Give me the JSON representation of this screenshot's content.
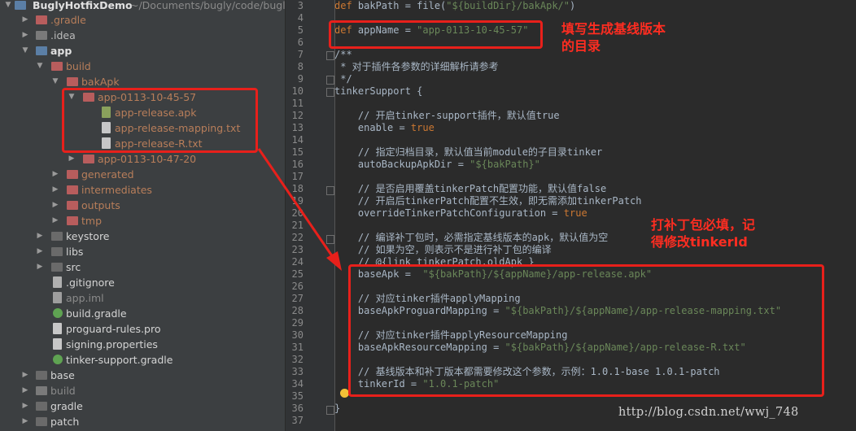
{
  "tree": {
    "root": {
      "label": "BuglyHotfixDemo",
      "path": "~/Documents/bugly/code/bugly-"
    },
    "items": [
      {
        "label": ".gradle"
      },
      {
        "label": ".idea"
      },
      {
        "label": "app"
      },
      {
        "label": "build"
      },
      {
        "label": "bakApk"
      },
      {
        "label": "app-0113-10-45-57"
      },
      {
        "label": "app-release.apk"
      },
      {
        "label": "app-release-mapping.txt"
      },
      {
        "label": "app-release-R.txt"
      },
      {
        "label": "app-0113-10-47-20"
      },
      {
        "label": "generated"
      },
      {
        "label": "intermediates"
      },
      {
        "label": "outputs"
      },
      {
        "label": "tmp"
      },
      {
        "label": "keystore"
      },
      {
        "label": "libs"
      },
      {
        "label": "src"
      },
      {
        "label": ".gitignore"
      },
      {
        "label": "app.iml"
      },
      {
        "label": "build.gradle"
      },
      {
        "label": "proguard-rules.pro"
      },
      {
        "label": "signing.properties"
      },
      {
        "label": "tinker-support.gradle"
      },
      {
        "label": "base"
      },
      {
        "label": "build"
      },
      {
        "label": "gradle"
      },
      {
        "label": "patch"
      }
    ]
  },
  "gutter": {
    "line_numbers": [
      "3",
      "4",
      "5",
      "6",
      "7",
      "8",
      "9",
      "10",
      "11",
      "12",
      "13",
      "14",
      "15",
      "16",
      "17",
      "18",
      "19",
      "20",
      "21",
      "22",
      "23",
      "24",
      "25",
      "26",
      "27",
      "28",
      "29",
      "30",
      "31",
      "32",
      "33",
      "34",
      "35",
      "36",
      "37"
    ]
  },
  "code": {
    "l3": {
      "a": "def ",
      "b": "bakPath",
      "c": " = file(",
      "d": "\"${buildDir}/bakApk/\"",
      "e": ")"
    },
    "l5": {
      "a": "def ",
      "b": "appName",
      "c": " = ",
      "d": "\"app-0113-10-45-57\""
    },
    "l7": "/**",
    "l8": " * 对于插件各参数的详细解析请参考",
    "l9": " */",
    "l10": "tinkerSupport {",
    "l12": "    // 开启tinker-support插件，默认值true",
    "l13": {
      "a": "    enable = ",
      "b": "true"
    },
    "l15": "    // 指定归档目录，默认值当前module的子目录tinker",
    "l16": {
      "a": "    autoBackupApkDir = ",
      "b": "\"${bakPath}\""
    },
    "l18": "    // 是否启用覆盖tinkerPatch配置功能，默认值false",
    "l19": "    // 开启后tinkerPatch配置不生效，即无需添加tinkerPatch",
    "l20": {
      "a": "    overrideTinkerPatchConfiguration = ",
      "b": "true"
    },
    "l22": "    // 编译补丁包时，必需指定基线版本的apk，默认值为空",
    "l23": "    // 如果为空，则表示不是进行补丁包的编译",
    "l24": "    // @{link tinkerPatch.oldApk }",
    "l25": {
      "a": "    baseApk =  ",
      "b": "\"${bakPath}/${appName}/app-release.apk\""
    },
    "l27": "    // 对应tinker插件applyMapping",
    "l28": {
      "a": "    baseApkProguardMapping = ",
      "b": "\"${bakPath}/${appName}/app-release-mapping.txt\""
    },
    "l30": "    // 对应tinker插件applyResourceMapping",
    "l31": {
      "a": "    baseApkResourceMapping = ",
      "b": "\"${bakPath}/${appName}/app-release-R.txt\""
    },
    "l33": "    // 基线版本和补丁版本都需要修改这个参数，示例：1.0.1-base 1.0.1-patch",
    "l34": {
      "a": "    tinkerId = ",
      "b": "\"1.0.1-patch\""
    },
    "l36": "}"
  },
  "annotations": {
    "note1": "填写生成基线版本\n的目录",
    "note2": "打补丁包必填，记\n得修改tinkerId"
  },
  "watermark": "http://blog.csdn.net/wwj_748",
  "colors": {
    "annotation_red": "#e8201b",
    "keyword": "#cc7832",
    "string": "#6a8759",
    "comment": "#808080",
    "background": "#2b2b2b"
  }
}
